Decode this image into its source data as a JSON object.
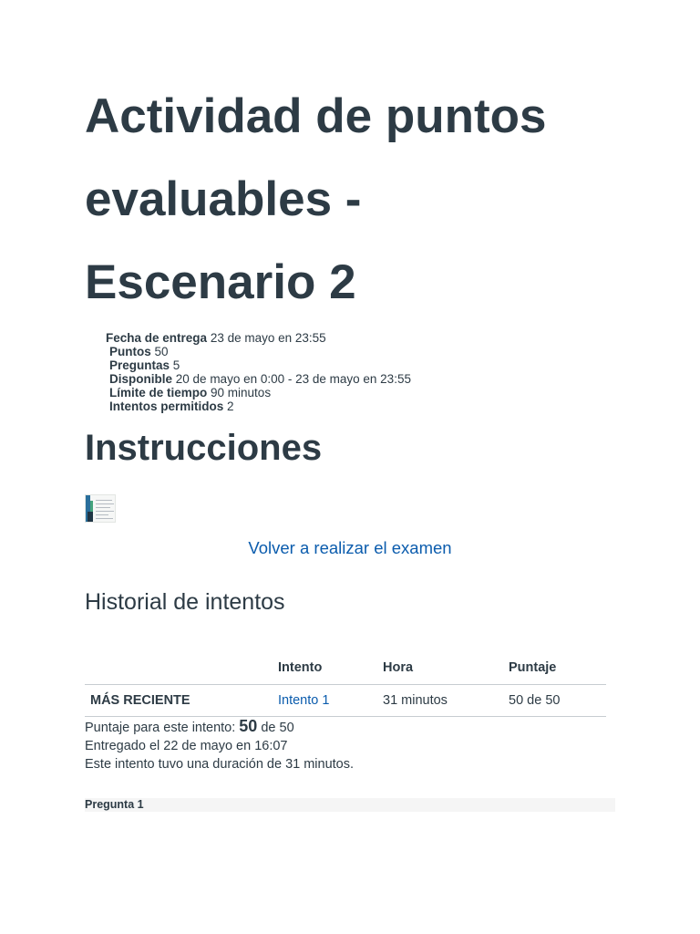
{
  "title_lines": [
    "Actividad de puntos",
    "evaluables -",
    "Escenario 2"
  ],
  "details": [
    {
      "label": "Fecha de entrega",
      "value": "23 de mayo en 23:55"
    },
    {
      "label": "Puntos",
      "value": "50"
    },
    {
      "label": "Preguntas",
      "value": "5"
    },
    {
      "label": "Disponible",
      "value": "20 de mayo en 0:00 - 23 de mayo en 23:55"
    },
    {
      "label": "Límite de tiempo",
      "value": "90 minutos"
    },
    {
      "label": "Intentos permitidos",
      "value": "2"
    }
  ],
  "instructions_title": "Instrucciones",
  "instructions_icon": "document-thumbnail-icon",
  "retake_link": "Volver a realizar el examen",
  "history": {
    "title": "Historial de intentos",
    "headers": [
      "",
      "Intento",
      "Hora",
      "Puntaje"
    ],
    "rows": [
      {
        "label": "MÁS RECIENTE",
        "attempt": "Intento 1",
        "time": "31 minutos",
        "score": "50 de 50"
      }
    ]
  },
  "summary": {
    "score_prefix": "Puntaje para este intento:",
    "score_value": "50",
    "score_suffix": "de 50",
    "submitted": "Entregado el 22 de mayo en 16:07",
    "duration": "Este intento tuvo una duración de 31 minutos."
  },
  "question_header": "Pregunta 1",
  "colors": {
    "text": "#2d3b45",
    "link": "#0b5cad",
    "rule": "#c7cdd1",
    "question_bar": "#f5f5f5"
  }
}
